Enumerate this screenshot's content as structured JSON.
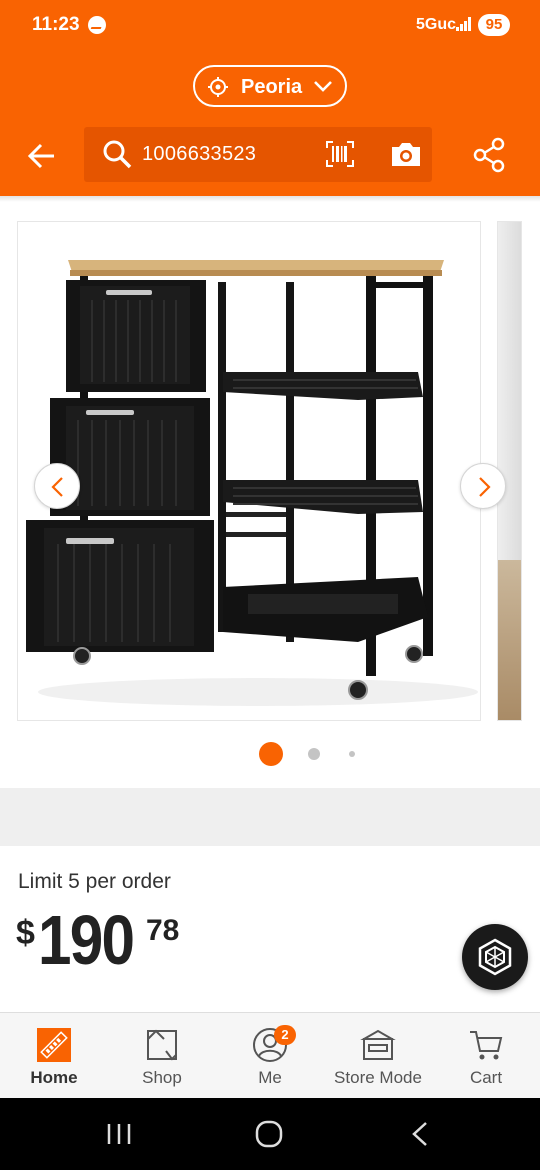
{
  "status_bar": {
    "time": "11:23",
    "network": "5Guc",
    "battery": "95",
    "icons": [
      "messenger-icon",
      "signal-icon",
      "battery-icon"
    ]
  },
  "header": {
    "store_name": "Peoria",
    "search_value": "1006633523",
    "icons": [
      "back-arrow-icon",
      "location-icon",
      "chevron-down-icon",
      "search-icon",
      "barcode-scan-icon",
      "camera-icon",
      "share-icon"
    ]
  },
  "gallery": {
    "image_subject": "black kitchen cart with wood top, three drawers and slatted shelves",
    "dot_count": 3,
    "active_dot": 0
  },
  "product": {
    "limit_text": "Limit 5 per order",
    "price_currency": "$",
    "price_dollars": "190",
    "price_cents": "78"
  },
  "bottom_nav": {
    "items": [
      {
        "label": "Home",
        "icon": "home-depot-logo-icon",
        "active": true
      },
      {
        "label": "Shop",
        "icon": "shop-icon",
        "active": false
      },
      {
        "label": "Me",
        "icon": "user-icon",
        "active": false,
        "badge": "2"
      },
      {
        "label": "Store Mode",
        "icon": "store-icon",
        "active": false
      },
      {
        "label": "Cart",
        "icon": "cart-icon",
        "active": false
      }
    ]
  },
  "colors": {
    "brand_orange": "#f96302",
    "search_bg": "#e55500",
    "nav_bg": "#f6f6f6"
  }
}
